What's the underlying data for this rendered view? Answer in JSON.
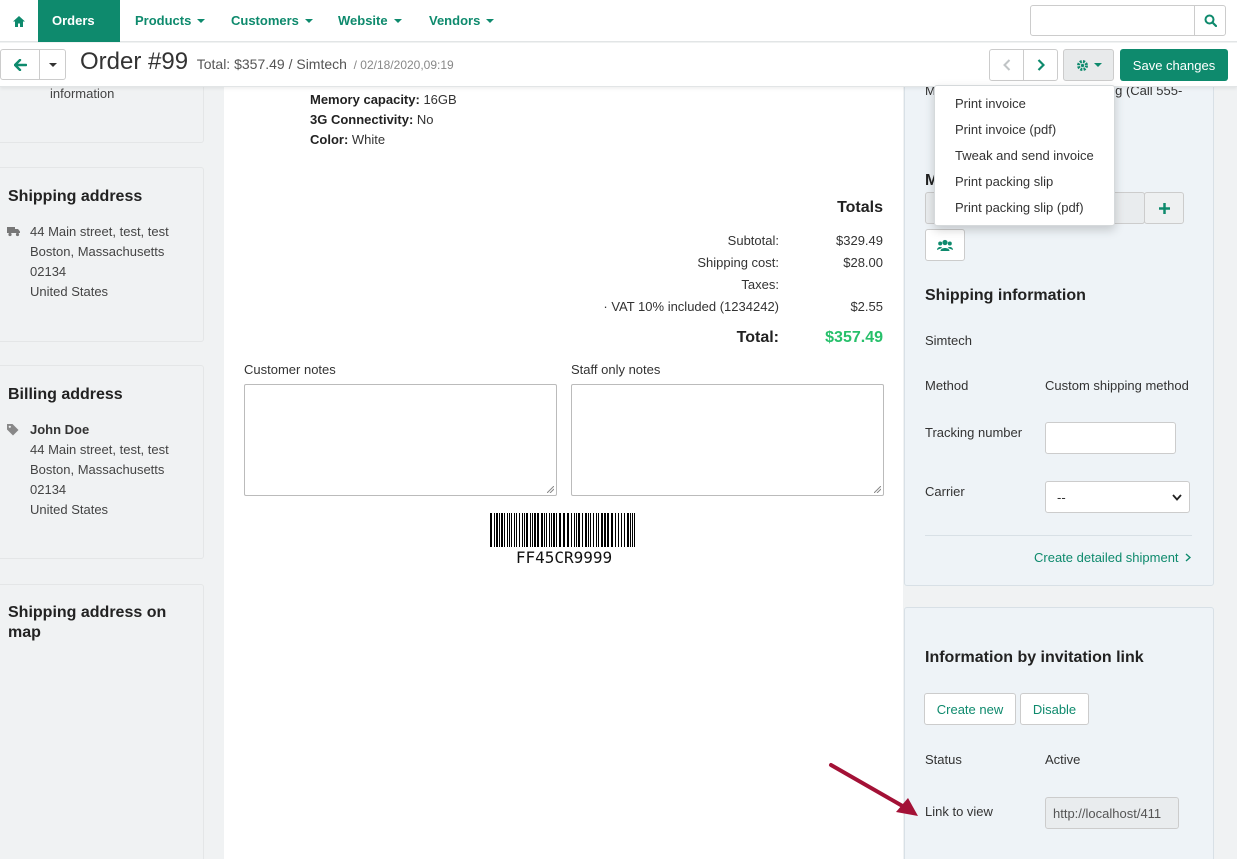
{
  "nav": {
    "items": [
      "Orders",
      "Products",
      "Customers",
      "Website",
      "Vendors"
    ],
    "search": {
      "placeholder": ""
    }
  },
  "header": {
    "title": "Order #99",
    "subtitle": "Total: $357.49 / Simtech",
    "date": "/ 02/18/2020,09:19",
    "save_label": "Save changes"
  },
  "dropdown": {
    "items": [
      "Print invoice",
      "Print invoice (pdf)",
      "Tweak and send invoice",
      "Print packing slip",
      "Print packing slip (pdf)"
    ]
  },
  "left": {
    "top_fragment": "information",
    "shipping_address": {
      "heading": "Shipping address",
      "lines": [
        "44 Main street, test, test",
        "Boston, Massachusetts",
        "02134",
        "United States"
      ]
    },
    "billing_address": {
      "heading": "Billing address",
      "name": "John Doe",
      "lines": [
        "44 Main street, test, test",
        "Boston, Massachusetts",
        "02134",
        "United States"
      ]
    },
    "map": {
      "heading_line1": "Shipping address on",
      "heading_line2": "map"
    }
  },
  "product": {
    "options": [
      {
        "label": "Memory capacity:",
        "value": " 16GB"
      },
      {
        "label": "3G Connectivity:",
        "value": " No"
      },
      {
        "label": "Color:",
        "value": " White"
      }
    ]
  },
  "totals": {
    "heading": "Totals",
    "rows": [
      {
        "label": "Subtotal:",
        "value": "$329.49"
      },
      {
        "label": "Shipping cost:",
        "value": "$28.00"
      },
      {
        "label": "Taxes:",
        "value": ""
      },
      {
        "label": "· VAT 10% included (1234242)",
        "value": "$2.55"
      }
    ],
    "total_label": "Total:",
    "total_value": "$357.49"
  },
  "notes": {
    "customer_label": "Customer notes",
    "staff_label": "Staff only notes"
  },
  "barcode": {
    "text": "FF45CR9999"
  },
  "right": {
    "top_fragment_a": "M",
    "top_fragment_b": "ing (Call 555-",
    "manager_fragment": "M",
    "shipping": {
      "heading": "Shipping information",
      "carrier_name": "Simtech",
      "method_label": "Method",
      "method_value": "Custom shipping method",
      "tracking_label": "Tracking number",
      "tracking_value": "",
      "carrier_label": "Carrier",
      "carrier_value": "--",
      "create_link": "Create detailed shipment"
    },
    "invitation": {
      "heading": "Information by invitation link",
      "create_label": "Create new",
      "disable_label": "Disable",
      "status_label": "Status",
      "status_value": "Active",
      "link_label": "Link to view",
      "link_value": "http://localhost/411"
    }
  },
  "colors": {
    "brand": "#0e8a6d",
    "total": "#27c06b",
    "arrow": "#a31136"
  }
}
